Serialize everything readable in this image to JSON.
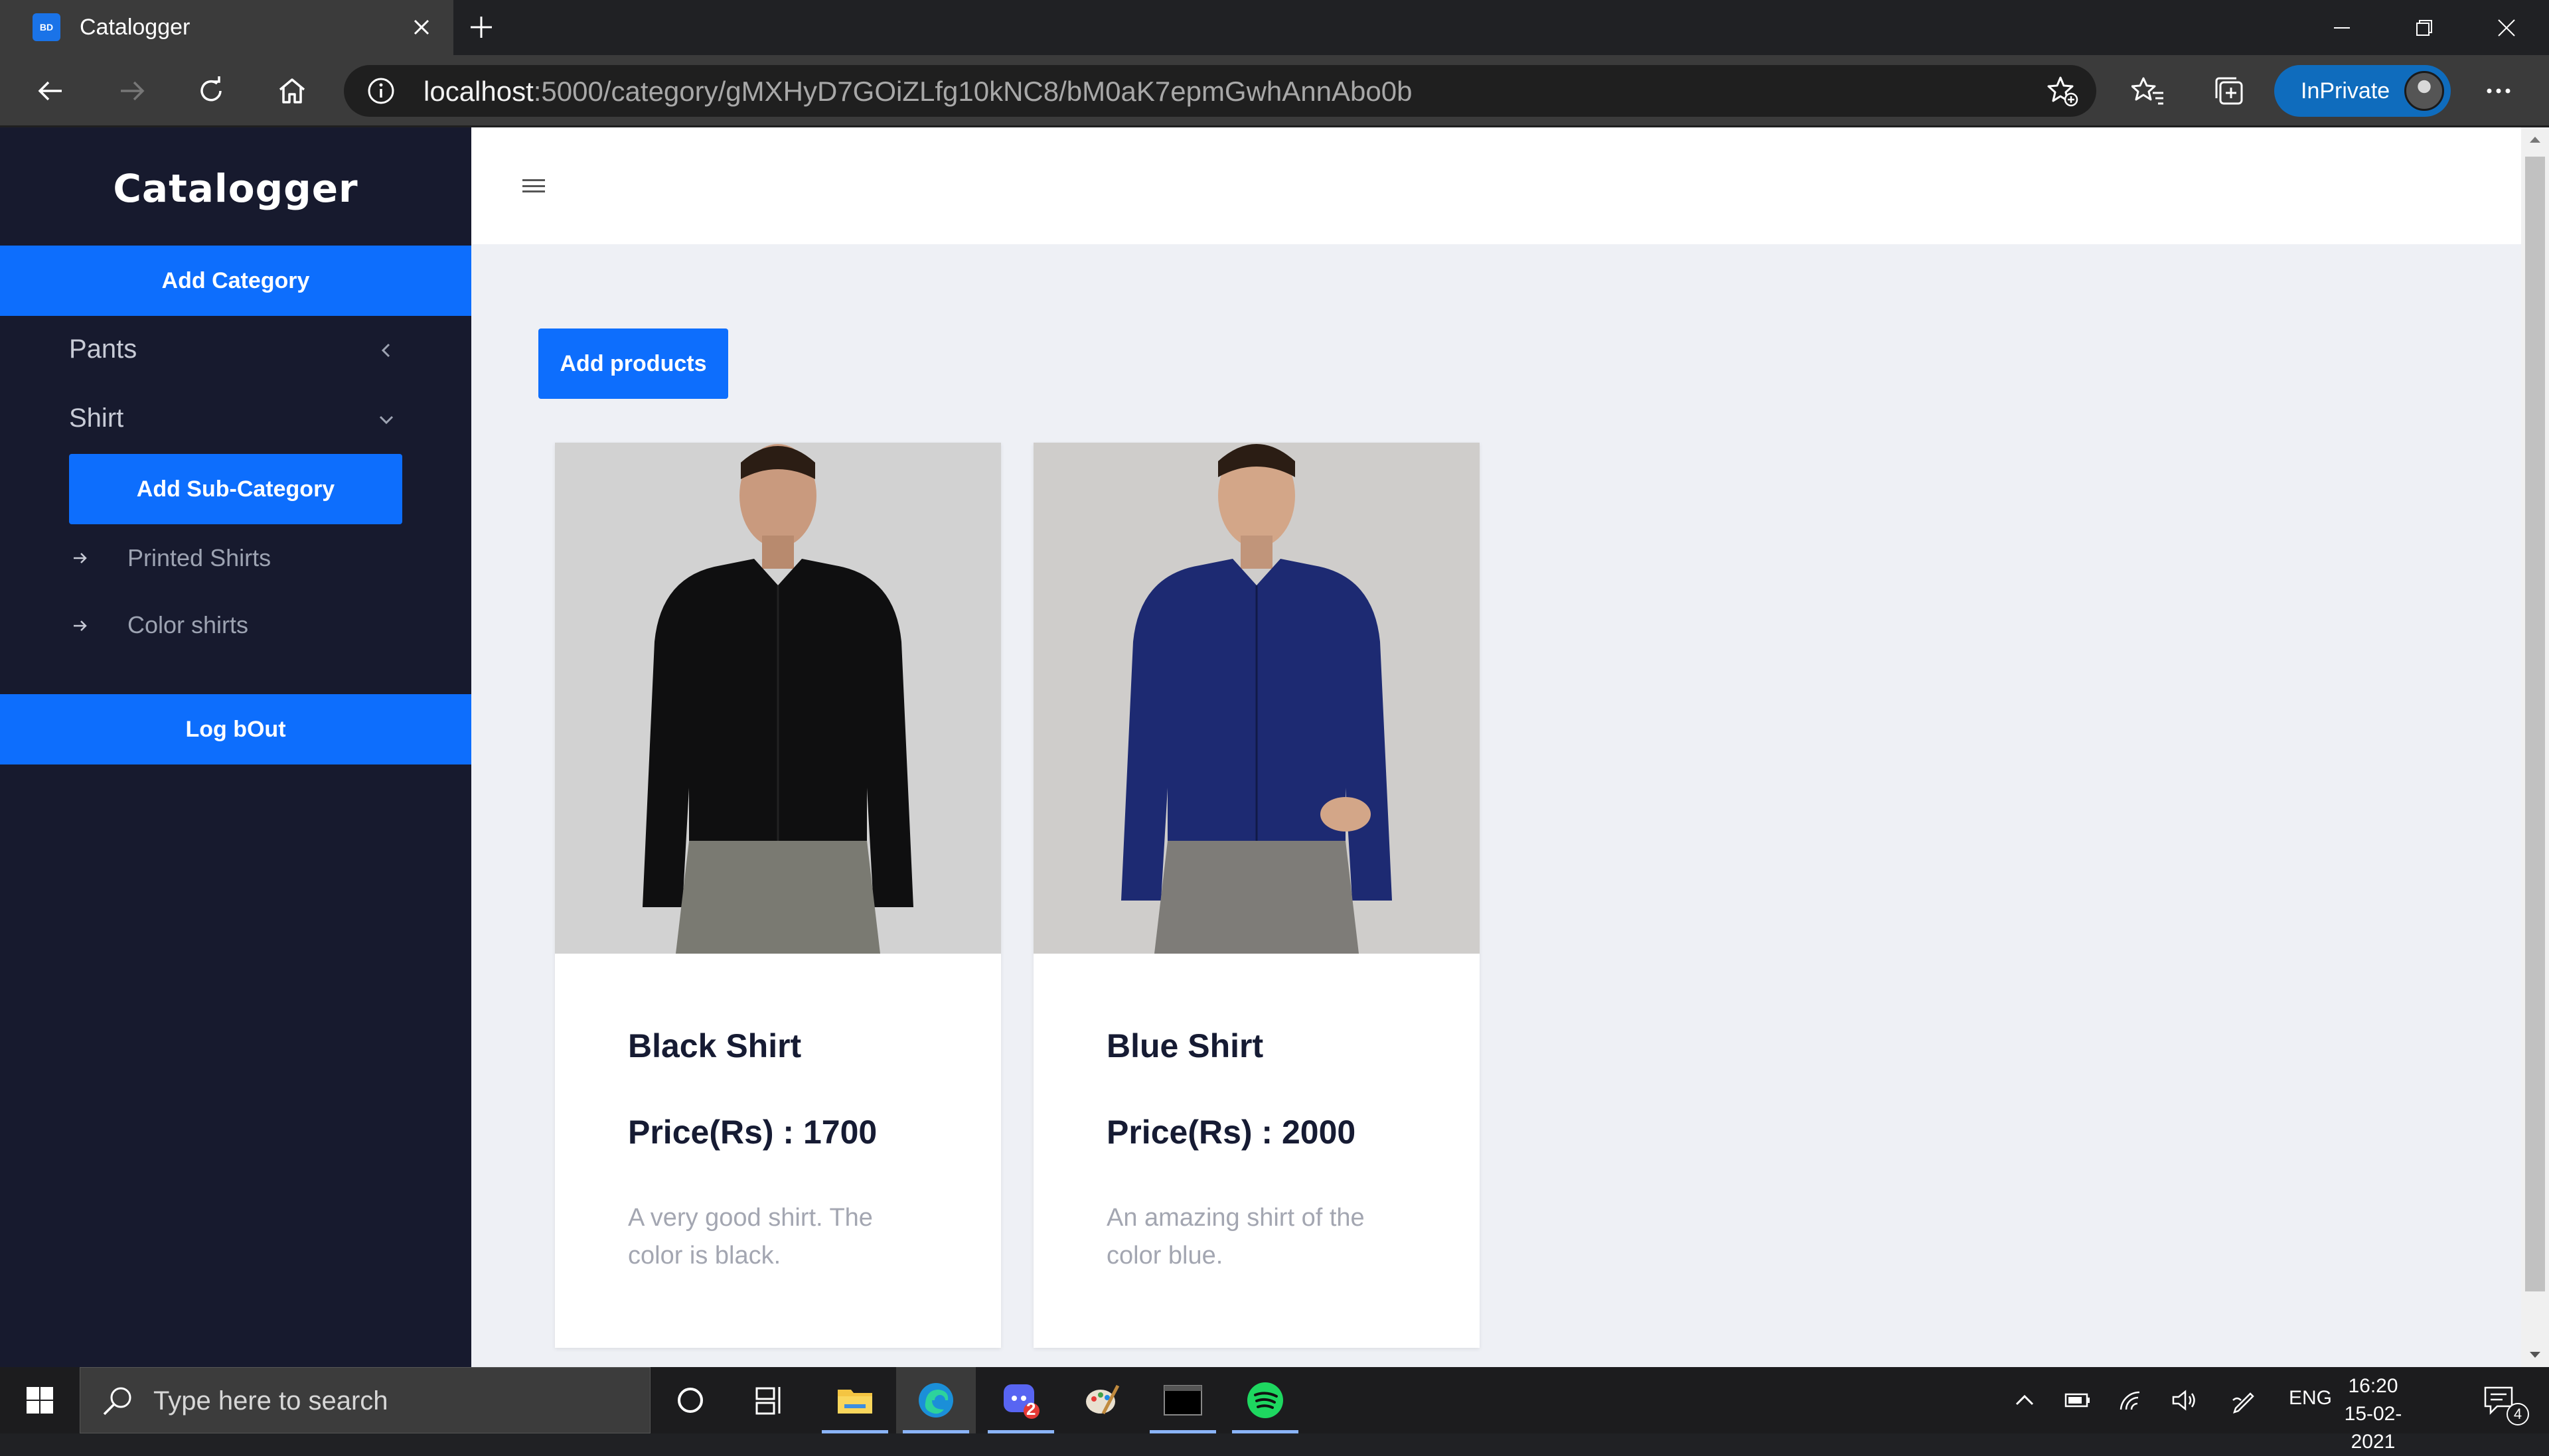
{
  "browser": {
    "tab_title": "Catalogger",
    "favicon_text": "BD",
    "url_host": "localhost",
    "url_path": ":5000/category/gMXHyD7GOiZLfg10kNC8/bM0aK7epmGwhAnnAbo0b",
    "inprivate_label": "InPrivate"
  },
  "sidebar": {
    "brand": "Catalogger",
    "add_category_label": "Add Category",
    "categories": [
      {
        "label": "Pants",
        "state": "collapsed"
      },
      {
        "label": "Shirt",
        "state": "expanded"
      }
    ],
    "add_subcategory_label": "Add Sub-Category",
    "subcategories": [
      "Printed Shirts",
      "Color shirts"
    ],
    "logout_label": "Log bOut"
  },
  "main": {
    "add_products_label": "Add products",
    "products": [
      {
        "name": "Black Shirt",
        "price": "Price(Rs) : 1700",
        "description": "A very good shirt. The color is black.",
        "shirt_color": "#0f0f10"
      },
      {
        "name": "Blue Shirt",
        "price": "Price(Rs) : 2000",
        "description": "An amazing shirt of the color blue.",
        "shirt_color": "#1d2a72"
      }
    ]
  },
  "taskbar": {
    "search_placeholder": "Type here to search",
    "language": "ENG",
    "time": "16:20",
    "date": "15-02-2021",
    "discord_badge": "2",
    "notification_count": "4"
  },
  "colors": {
    "accent": "#0d6efd",
    "sidebar_bg": "#171a2e",
    "page_bg": "#eef0f5"
  }
}
